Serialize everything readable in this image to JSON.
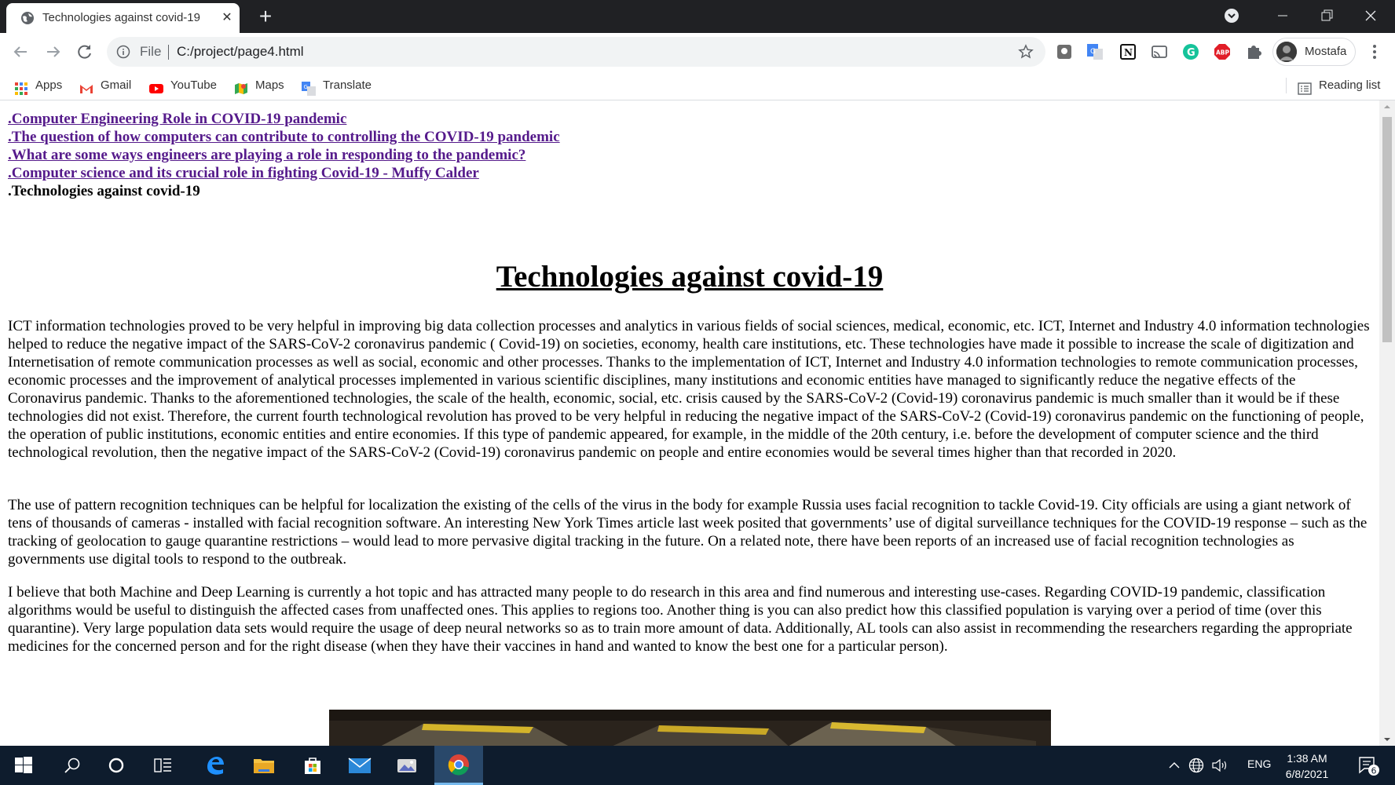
{
  "browser": {
    "tab_title": "Technologies against covid-19",
    "omnibox": {
      "scheme_label": "File",
      "url": "C:/project/page4.html"
    },
    "profile_name": "Mostafa",
    "bookmarks": [
      {
        "label": "Apps"
      },
      {
        "label": "Gmail"
      },
      {
        "label": "YouTube"
      },
      {
        "label": "Maps"
      },
      {
        "label": "Translate"
      }
    ],
    "reading_list_label": "Reading list"
  },
  "page": {
    "toc": [
      {
        "label": ".Computer Engineering Role in COVID-19 pandemic",
        "visited": true
      },
      {
        "label": ".The question of how computers can contribute to controlling the COVID-19 pandemic",
        "visited": true
      },
      {
        "label": ".What are some ways engineers are playing a role in responding to the pandemic?",
        "visited": true
      },
      {
        "label": ".Computer science and its crucial role in fighting Covid-19 - Muffy Calder",
        "visited": true
      },
      {
        "label": ".Technologies against covid-19",
        "current": true
      }
    ],
    "title": "Technologies against covid-19",
    "paragraphs": [
      "ICT information technologies proved to be very helpful in improving big data collection processes and analytics in various fields of social sciences, medical, economic, etc. ICT, Internet and Industry 4.0 information technologies helped to reduce the negative impact of the SARS-CoV-2 coronavirus pandemic ( Covid-19) on societies, economy, health care institutions, etc. These technologies have made it possible to increase the scale of digitization and Internetisation of remote communication processes as well as social, economic and other processes. Thanks to the implementation of ICT, Internet and Industry 4.0 information technologies to remote communication processes, economic processes and the improvement of analytical processes implemented in various scientific disciplines, many institutions and economic entities have managed to significantly reduce the negative effects of the Coronavirus pandemic. Thanks to the aforementioned technologies, the scale of the health, economic, social, etc. crisis caused by the SARS-CoV-2 (Covid-19) coronavirus pandemic is much smaller than it would be if these technologies did not exist. Therefore, the current fourth technological revolution has proved to be very helpful in reducing the negative impact of the SARS-CoV-2 (Covid-19) coronavirus pandemic on the functioning of people, the operation of public institutions, economic entities and entire economies. If this type of pandemic appeared, for example, in the middle of the 20th century, i.e. before the development of computer science and the third technological revolution, then the negative impact of the SARS-CoV-2 (Covid-19) coronavirus pandemic on people and entire economies would be several times higher than that recorded in 2020.",
      "The use of pattern recognition techniques can be helpful for localization the existing of the cells of the virus in the body for example Russia uses facial recognition to tackle Covid-19. City officials are using a giant network of tens of thousands of cameras - installed with facial recognition software. An interesting New York Times article last week posited that governments’ use of digital surveillance techniques for the COVID-19 response – such as the tracking of geolocation to gauge quarantine restrictions – would lead to more pervasive digital tracking in the future. On a related note, there have been reports of an increased use of facial recognition technologies as governments use digital tools to respond to the outbreak.",
      "I believe that both Machine and Deep Learning is currently a hot topic and has attracted many people to do research in this area and find numerous and interesting use-cases. Regarding COVID-19 pandemic, classification algorithms would be useful to distinguish the affected cases from unaffected ones. This applies to regions too. Another thing is you can also predict how this classified population is varying over a period of time (over this quarantine). Very large population data sets would require the usage of deep neural networks so as to train more amount of data. Additionally, AL tools can also assist in recommending the researchers regarding the appropriate medicines for the concerned person and for the right disease (when they have their vaccines in hand and wanted to know the best one for a particular person)."
    ]
  },
  "taskbar": {
    "language": "ENG",
    "time": "1:38 AM",
    "date": "6/8/2021",
    "notification_count": "6"
  },
  "colors": {
    "link_visited": "#551a8b",
    "titlebar": "#202124",
    "taskbar": "#0e1c2d"
  }
}
